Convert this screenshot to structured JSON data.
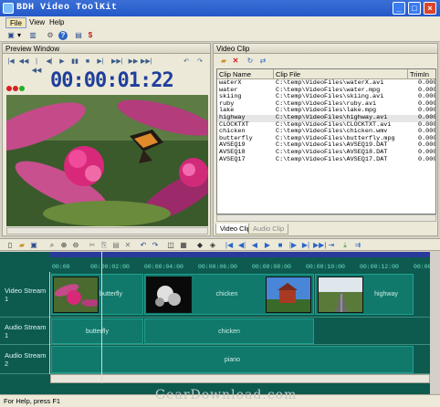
{
  "window": {
    "title": "BDH Video ToolKit",
    "min": "_",
    "max": "□",
    "close": "×"
  },
  "menu": {
    "items": [
      "File",
      "View",
      "Help"
    ]
  },
  "toolbar": {
    "icons": [
      "save-icon",
      "disk-icon",
      "settings-icon",
      "help-icon",
      "open-icon",
      "buy-icon"
    ],
    "glyphs": [
      "▣",
      "▾",
      "▥",
      "⚙",
      "?",
      "▤",
      "$"
    ]
  },
  "preview": {
    "header": "Preview Window",
    "timecode": "00:00:01:22",
    "controls": [
      "|◀",
      "◀◀",
      "|◀◀",
      "◀|",
      "▶",
      "▮▮",
      "■",
      "▶|",
      "▶▶|",
      "▶▶",
      "↶",
      "↷"
    ]
  },
  "clip_panel": {
    "header": "Video Clip",
    "columns": [
      "Clip Name",
      "Clip File",
      "TrimIn"
    ],
    "rows": [
      {
        "name": "waterX",
        "file": "C:\\temp\\VideoFiles\\waterX.avi",
        "trim": "0.000"
      },
      {
        "name": "water",
        "file": "C:\\temp\\VideoFiles\\water.mpg",
        "trim": "0.000"
      },
      {
        "name": "skiing",
        "file": "C:\\temp\\VideoFiles\\skiing.avi",
        "trim": "0.000"
      },
      {
        "name": "ruby",
        "file": "C:\\temp\\VideoFiles\\ruby.avi",
        "trim": "0.000"
      },
      {
        "name": "lake",
        "file": "C:\\temp\\VideoFiles\\lake.mpg",
        "trim": "0.000"
      },
      {
        "name": "highway",
        "file": "C:\\temp\\VideoFiles\\highway.avi",
        "trim": "0.000"
      },
      {
        "name": "CLOCKTXT",
        "file": "C:\\temp\\VideoFiles\\CLOCKTXT.avi",
        "trim": "0.000"
      },
      {
        "name": "chicken",
        "file": "C:\\temp\\VideoFiles\\chicken.wmv",
        "trim": "0.000"
      },
      {
        "name": "butterfly",
        "file": "C:\\temp\\VideoFiles\\butterfly.mpg",
        "trim": "0.000"
      },
      {
        "name": "AVSEQ19",
        "file": "C:\\temp\\VideoFiles\\AVSEQ19.DAT",
        "trim": "0.000"
      },
      {
        "name": "AVSEQ18",
        "file": "C:\\temp\\VideoFiles\\AVSEQ18.DAT",
        "trim": "0.000"
      },
      {
        "name": "AVSEQ17",
        "file": "C:\\temp\\VideoFiles\\AVSEQ17.DAT",
        "trim": "0.000"
      }
    ],
    "selected_row": 5,
    "tabs": [
      "Video Clip",
      "Audio Clip"
    ]
  },
  "timeline": {
    "ruler_ticks": [
      "00:00",
      "00:00:02:00",
      "00:00:04:00",
      "00:00:06:00",
      "00:00:08:00",
      "00:00:10:00",
      "00:00:12:00",
      "00:00:1"
    ],
    "tracks": [
      {
        "label": "Video Stream 1",
        "clips": [
          "butterfly",
          "chicken",
          "",
          "highway"
        ]
      },
      {
        "label": "Audio Stream 1",
        "clips": [
          "butterfly",
          "chicken"
        ]
      },
      {
        "label": "Audio Stream 2",
        "clips": [
          "piano"
        ]
      }
    ]
  },
  "status": {
    "text": "For Help, press F1",
    "watermark": "GearDownload.com"
  },
  "colors": {
    "title_bar": "#2458c8",
    "timeline_bg": "#0d5a4f",
    "clip_fill": "#11796c",
    "timecode": "#1f3e9c"
  }
}
